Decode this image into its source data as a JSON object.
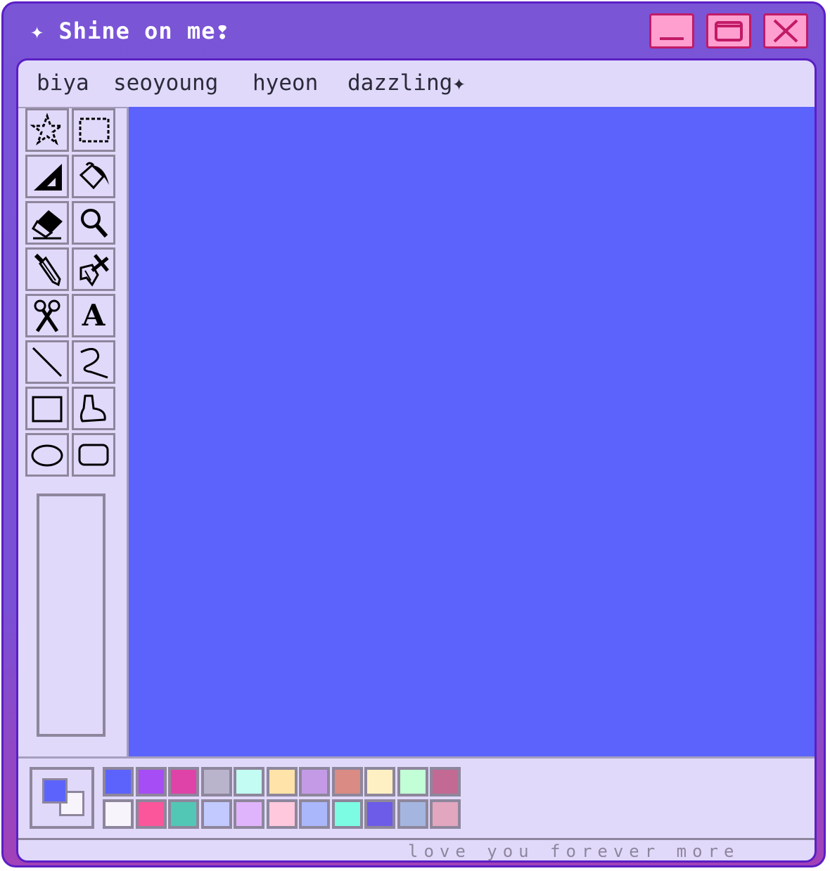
{
  "window": {
    "title": "✦ Shine on me❢",
    "controls": {
      "minimize": "minimize-icon",
      "maximize": "maximize-icon",
      "close": "close-icon"
    }
  },
  "menu": {
    "items": [
      "biya",
      "seoyoung",
      "hyeon",
      "dazzling✦"
    ]
  },
  "tools": [
    {
      "name": "free-select",
      "icon": "star-select-icon"
    },
    {
      "name": "rect-select",
      "icon": "rectangle-select-icon"
    },
    {
      "name": "triangle",
      "icon": "triangle-ruler-icon"
    },
    {
      "name": "fill",
      "icon": "paint-bucket-icon"
    },
    {
      "name": "eraser",
      "icon": "eraser-icon"
    },
    {
      "name": "magnifier",
      "icon": "magnifier-icon"
    },
    {
      "name": "pencil",
      "icon": "pencil-icon"
    },
    {
      "name": "brush",
      "icon": "brush-icon"
    },
    {
      "name": "scissors",
      "icon": "scissors-icon"
    },
    {
      "name": "text",
      "icon": "text-icon",
      "label": "A"
    },
    {
      "name": "line",
      "icon": "line-icon"
    },
    {
      "name": "curve",
      "icon": "curve-icon"
    },
    {
      "name": "rectangle",
      "icon": "rectangle-icon"
    },
    {
      "name": "polygon",
      "icon": "polygon-icon"
    },
    {
      "name": "ellipse",
      "icon": "ellipse-icon"
    },
    {
      "name": "rounded-rectangle",
      "icon": "rounded-rectangle-icon"
    }
  ],
  "canvas": {
    "color": "#5c63fc"
  },
  "current_colors": {
    "foreground": "#5c63fc",
    "background": "#f7f4fb"
  },
  "palette": {
    "row1": [
      "#5c63fc",
      "#a64df5",
      "#e043a8",
      "#b9b4cc",
      "#c2fcf2",
      "#ffe3a8",
      "#c49ae6",
      "#d98b84",
      "#fff0c4",
      "#c2ffd6",
      "#c26a93"
    ],
    "row2": [
      "#f7f4fb",
      "#fb559b",
      "#52c7b5",
      "#c2c9ff",
      "#e0b4fc",
      "#ffc8dd",
      "#aab7fa",
      "#7bfce3",
      "#6c5ce7",
      "#a4b6e0",
      "#e2a6be"
    ]
  },
  "status": {
    "text": "love you forever more"
  }
}
